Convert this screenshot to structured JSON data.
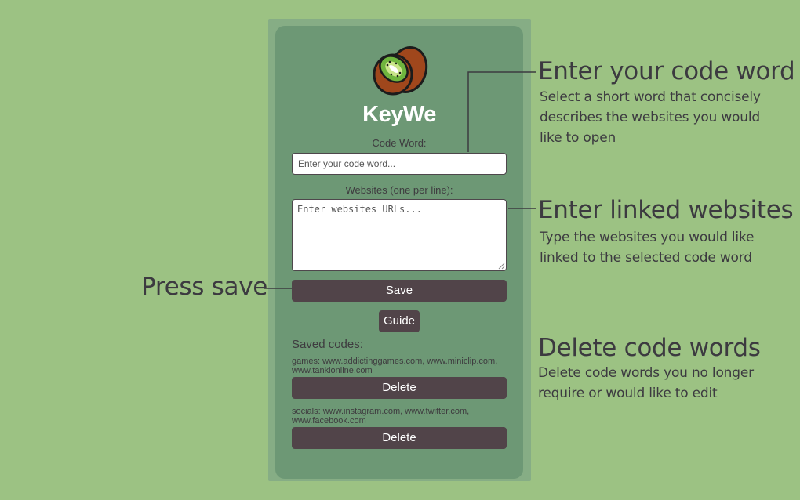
{
  "popup": {
    "brand": "KeyWe",
    "code_word_label": "Code Word:",
    "code_word_placeholder": "Enter your code word...",
    "websites_label": "Websites (one per line):",
    "websites_placeholder": "Enter websites URLs...",
    "save_label": "Save",
    "guide_label": "Guide",
    "saved_title": "Saved codes:",
    "saved": [
      {
        "text": "games: www.addictinggames.com, www.miniclip.com, www.tankionline.com",
        "delete_label": "Delete"
      },
      {
        "text": "socials: www.instagram.com, www.twitter.com, www.facebook.com",
        "delete_label": "Delete"
      }
    ]
  },
  "annotations": {
    "code_word": {
      "title": "Enter your code word",
      "lines": [
        "Select a short word that concisely",
        "describes the websites you would",
        "like to open"
      ]
    },
    "websites": {
      "title": "Enter linked websites",
      "lines": [
        "Type the websites you would like",
        "linked to the selected code word"
      ]
    },
    "save": {
      "title": "Press save"
    },
    "delete": {
      "title": "Delete code words",
      "lines": [
        "Delete code words you no longer",
        "require or would like to edit"
      ]
    }
  },
  "colors": {
    "background": "#9cc283",
    "popup": "#6d9875",
    "button": "#514449",
    "text": "#3c3a40"
  },
  "icons": {
    "logo": "kiwi-logo-icon"
  }
}
